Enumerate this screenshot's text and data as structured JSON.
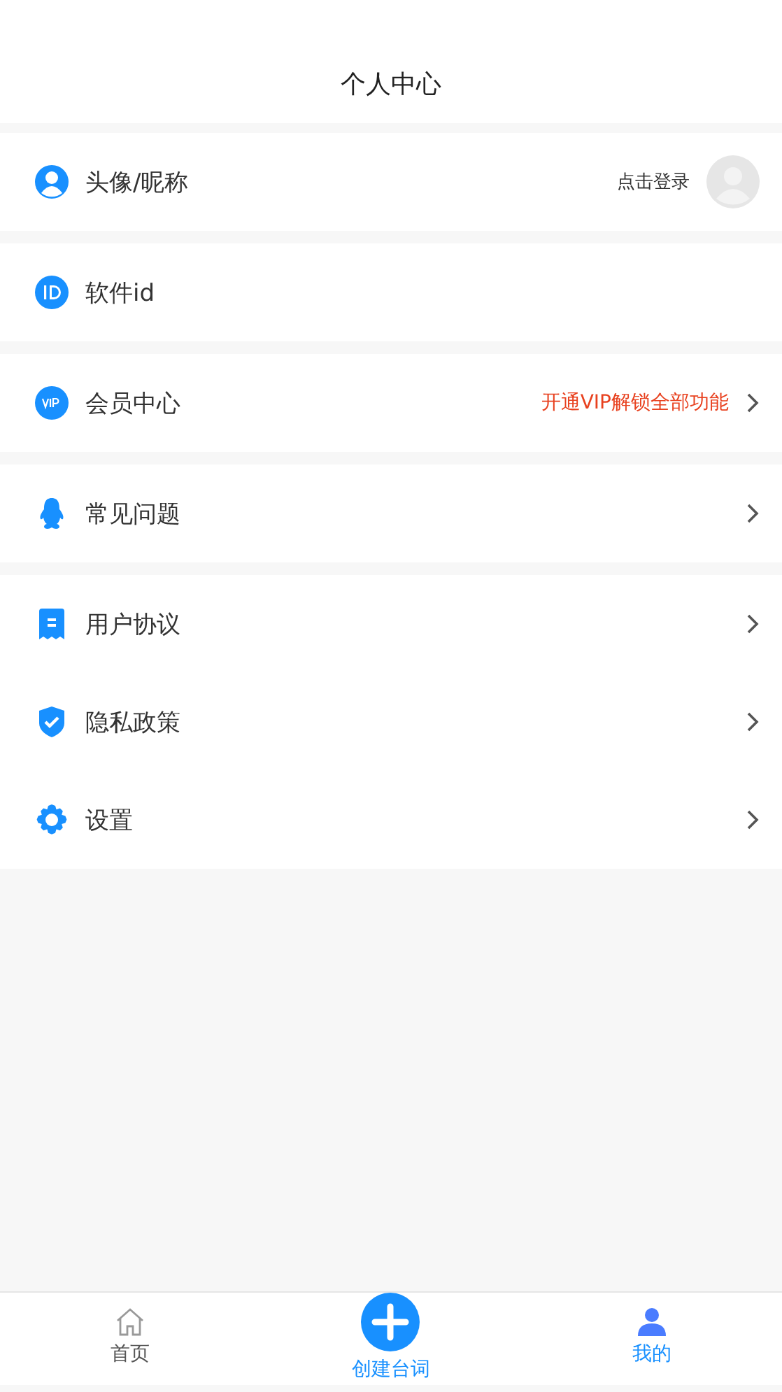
{
  "header": {
    "title": "个人中心"
  },
  "groups": [
    {
      "rows": [
        {
          "label": "头像/昵称",
          "hint": "点击登录",
          "hint_highlight": false,
          "avatar": true,
          "chevron": false
        }
      ]
    },
    {
      "rows": [
        {
          "label": "软件id",
          "avatar": false,
          "chevron": false
        }
      ]
    },
    {
      "rows": [
        {
          "label": "会员中心",
          "hint": "开通VIP解锁全部功能",
          "hint_highlight": true,
          "avatar": false,
          "chevron": true
        }
      ]
    },
    {
      "rows": [
        {
          "label": "常见问题",
          "avatar": false,
          "chevron": true
        }
      ]
    },
    {
      "rows": [
        {
          "label": "用户协议",
          "avatar": false,
          "chevron": true
        },
        {
          "label": "隐私政策",
          "avatar": false,
          "chevron": true
        },
        {
          "label": "设置",
          "avatar": false,
          "chevron": true
        }
      ]
    }
  ],
  "tab_bar": [
    {
      "label": "首页",
      "kind": "tab",
      "selected": false
    },
    {
      "label": "创建台词",
      "kind": "create"
    },
    {
      "label": "我的",
      "kind": "tab",
      "selected": true
    }
  ]
}
